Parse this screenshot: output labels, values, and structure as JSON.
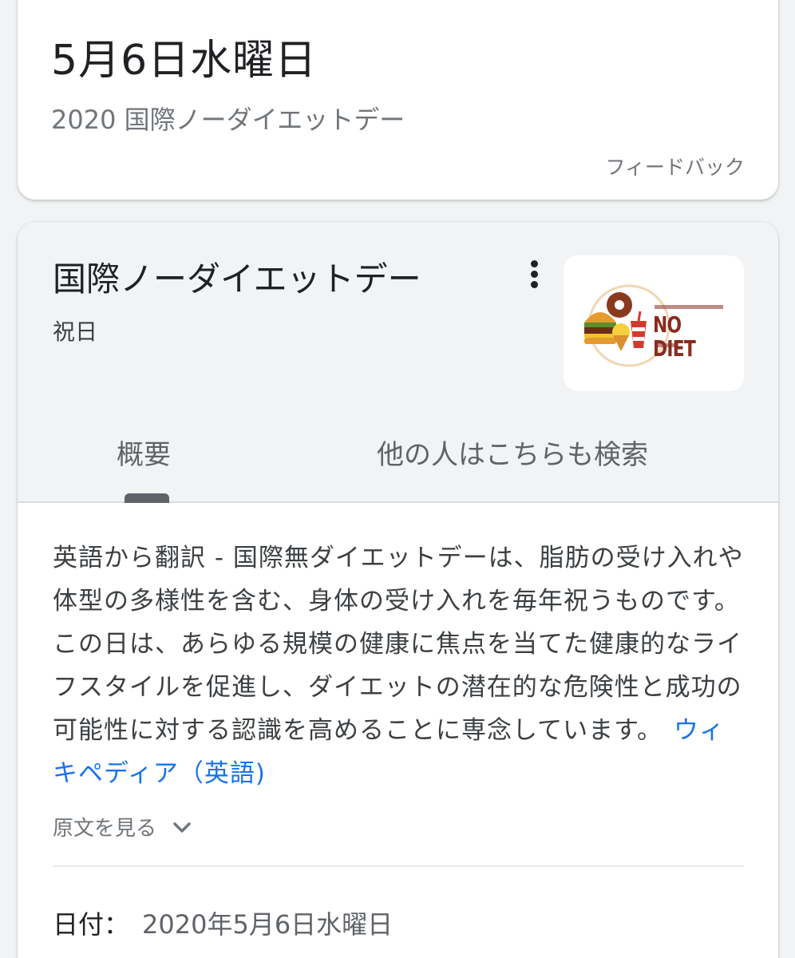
{
  "date_card": {
    "title": "5月6日水曜日",
    "subtitle": "2020 国際ノーダイエットデー",
    "feedback": "フィードバック"
  },
  "knowledge_panel": {
    "title": "国際ノーダイエットデー",
    "subtitle": "祝日",
    "thumbnail_logo_text": "NO DIET",
    "tabs": [
      {
        "label": "概要",
        "selected": true
      },
      {
        "label": "他の人はこちらも検索",
        "selected": false
      }
    ],
    "description": "英語から翻訳 - 国際無ダイエットデーは、脂肪の受け入れや体型の多様性を含む、身体の受け入れを毎年祝うものです。この日は、あらゆる規模の健康に焦点を当てた健康的なライフスタイルを促進し、ダイエットの潜在的な危険性と成功の可能性に対する認識を高めることに専念しています。",
    "source_link": "ウィキペディア（英語)",
    "show_original": "原文を見る",
    "date_label": "日付：",
    "date_value": "2020年5月6日水曜日"
  },
  "colors": {
    "link": "#1a73e8",
    "header_bg": "#f1f3f4",
    "secondary_text": "#70757a"
  }
}
